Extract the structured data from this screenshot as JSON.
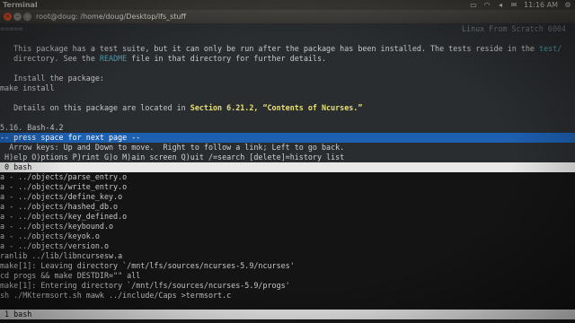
{
  "topbar": {
    "app_name": "Terminal",
    "time": "11:16 AM",
    "tray_icons": [
      "keyboard-icon",
      "wifi-icon",
      "volume-icon",
      "mail-icon"
    ]
  },
  "window": {
    "title": "root@doug: /home/doug/Desktop/lfs_stuff"
  },
  "top_pane": {
    "header_left": "=====",
    "header_right": "Linux From Scratch 6004",
    "para1_line1_a": "   This package has a test suite, but it can only be run after the package has been installed. The tests reside in the ",
    "para1_link1": "test/",
    "para1_line2_a": "   directory. See the ",
    "para1_link2": "README",
    "para1_line2_b": " file in that directory for further details.",
    "install_label": "   Install the package:",
    "install_cmd": "make install",
    "para2_a": "   Details on this package are located in ",
    "para2_link": "Section 6.21.2, “Contents of Ncurses.”",
    "section": "5.16. Bash-4.2",
    "status": "-- press space for next page --",
    "help1": "  Arrow keys: Up and Down to move.  Right to follow a link; Left to go back.",
    "help2": " H)elp O)ptions P)rint G)o M)ain screen Q)uit /=search [delete]=history list"
  },
  "window_bar_top": " 0 bash",
  "bottom_pane": {
    "lines": [
      "a - ../objects/parse_entry.o",
      "a - ../objects/write_entry.o",
      "a - ../objects/define_key.o",
      "a - ../objects/hashed_db.o",
      "a - ../objects/key_defined.o",
      "a - ../objects/keybound.o",
      "a - ../objects/keyok.o",
      "a - ../objects/version.o",
      "ranlib ../lib/libncursesw.a",
      "make[1]: Leaving directory `/mnt/lfs/sources/ncurses-5.9/ncurses'",
      "cd progs && make DESTDIR=\"\" all",
      "make[1]: Entering directory `/mnt/lfs/sources/ncurses-5.9/progs'",
      "sh ./MKtermsort.sh mawk ../include/Caps >termsort.c",
      ""
    ]
  },
  "window_bar_bottom": " 1 bash"
}
